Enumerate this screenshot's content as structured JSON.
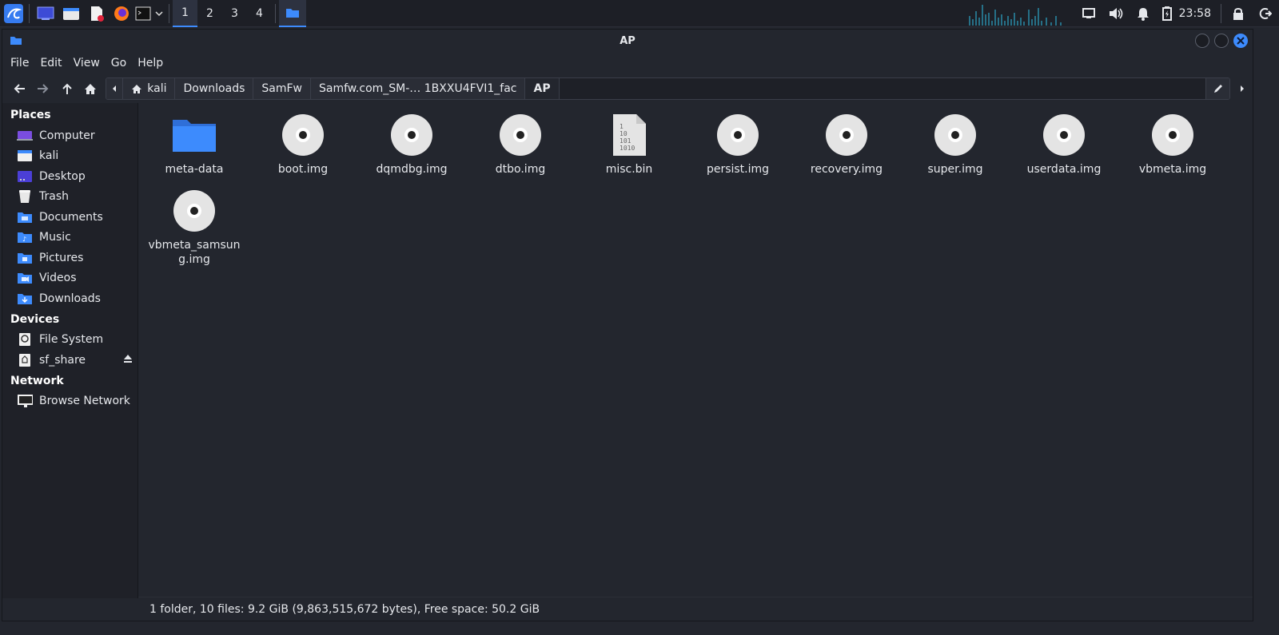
{
  "panel": {
    "workspaces": [
      "1",
      "2",
      "3",
      "4"
    ],
    "active_workspace": "1",
    "clock": "23:58",
    "accent": "#3d8bfd"
  },
  "window": {
    "title": "AP"
  },
  "menubar": {
    "items": [
      "File",
      "Edit",
      "View",
      "Go",
      "Help"
    ]
  },
  "pathbar": {
    "crumbs": [
      "kali",
      "Downloads",
      "SamFw",
      "Samfw.com_SM-… 1BXXU4FVI1_fac",
      "AP"
    ]
  },
  "sidebar": {
    "places_header": "Places",
    "places": [
      "Computer",
      "kali",
      "Desktop",
      "Trash",
      "Documents",
      "Music",
      "Pictures",
      "Videos",
      "Downloads"
    ],
    "devices_header": "Devices",
    "devices": [
      "File System",
      "sf_share"
    ],
    "network_header": "Network",
    "network": [
      "Browse Network"
    ]
  },
  "files": [
    {
      "name": "meta-data",
      "icon": "folder-icon"
    },
    {
      "name": "boot.img",
      "icon": "disc-image-icon"
    },
    {
      "name": "dqmdbg.img",
      "icon": "disc-image-icon"
    },
    {
      "name": "dtbo.img",
      "icon": "disc-image-icon"
    },
    {
      "name": "misc.bin",
      "icon": "binary-file-icon"
    },
    {
      "name": "persist.img",
      "icon": "disc-image-icon"
    },
    {
      "name": "recovery.img",
      "icon": "disc-image-icon"
    },
    {
      "name": "super.img",
      "icon": "disc-image-icon"
    },
    {
      "name": "userdata.img",
      "icon": "disc-image-icon"
    },
    {
      "name": "vbmeta.img",
      "icon": "disc-image-icon"
    },
    {
      "name": "vbmeta_samsung.img",
      "icon": "disc-image-icon"
    }
  ],
  "status": {
    "text": "1 folder, 10 files: 9.2 GiB (9,863,515,672 bytes), Free space: 50.2 GiB"
  }
}
